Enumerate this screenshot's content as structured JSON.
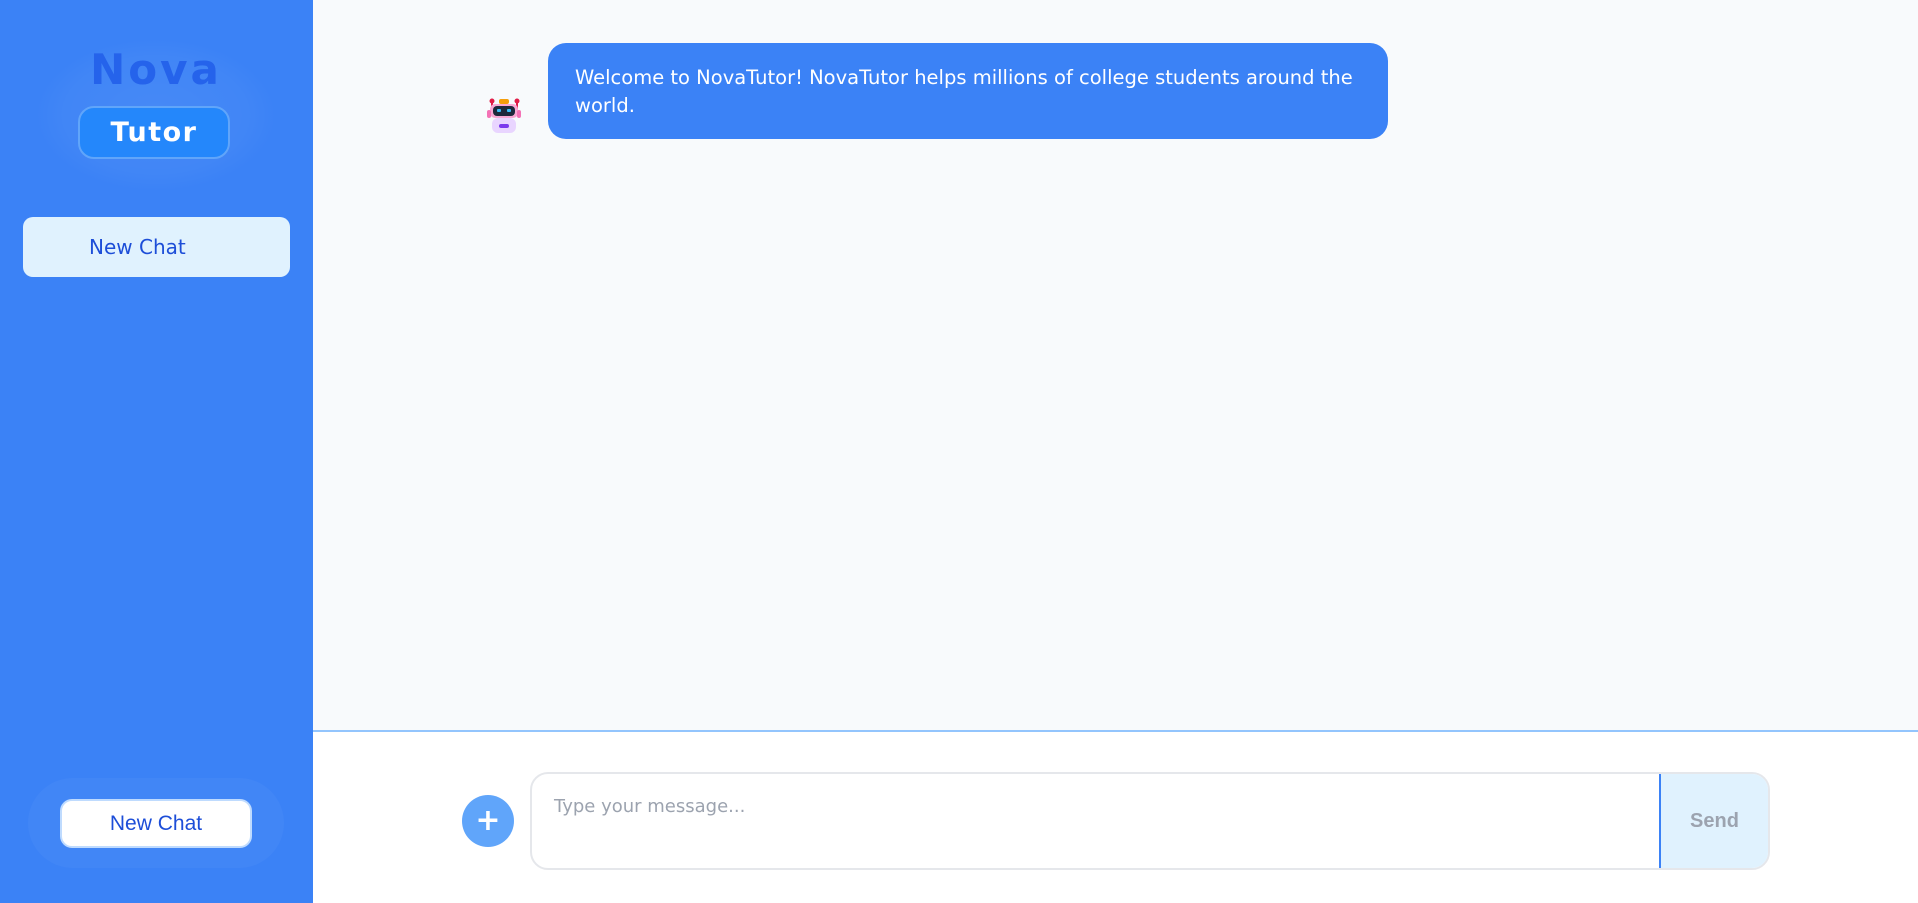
{
  "sidebar": {
    "logo": {
      "line1": "Nova",
      "line2": "Tutor"
    },
    "top_button_label": "New Chat",
    "bottom_button_label": "New Chat"
  },
  "chat": {
    "messages": [
      {
        "sender": "bot",
        "avatar_icon": "robot-icon",
        "text": "Welcome to NovaTutor! NovaTutor helps millions of college students around the world."
      }
    ]
  },
  "composer": {
    "attach_label": "+",
    "placeholder": "Type your message...",
    "value": "",
    "send_label": "Send"
  },
  "colors": {
    "sidebar_bg": "#3b82f6",
    "accent": "#2563eb",
    "bubble_bg": "#3b82f6",
    "send_bg": "#e0f2fe"
  }
}
